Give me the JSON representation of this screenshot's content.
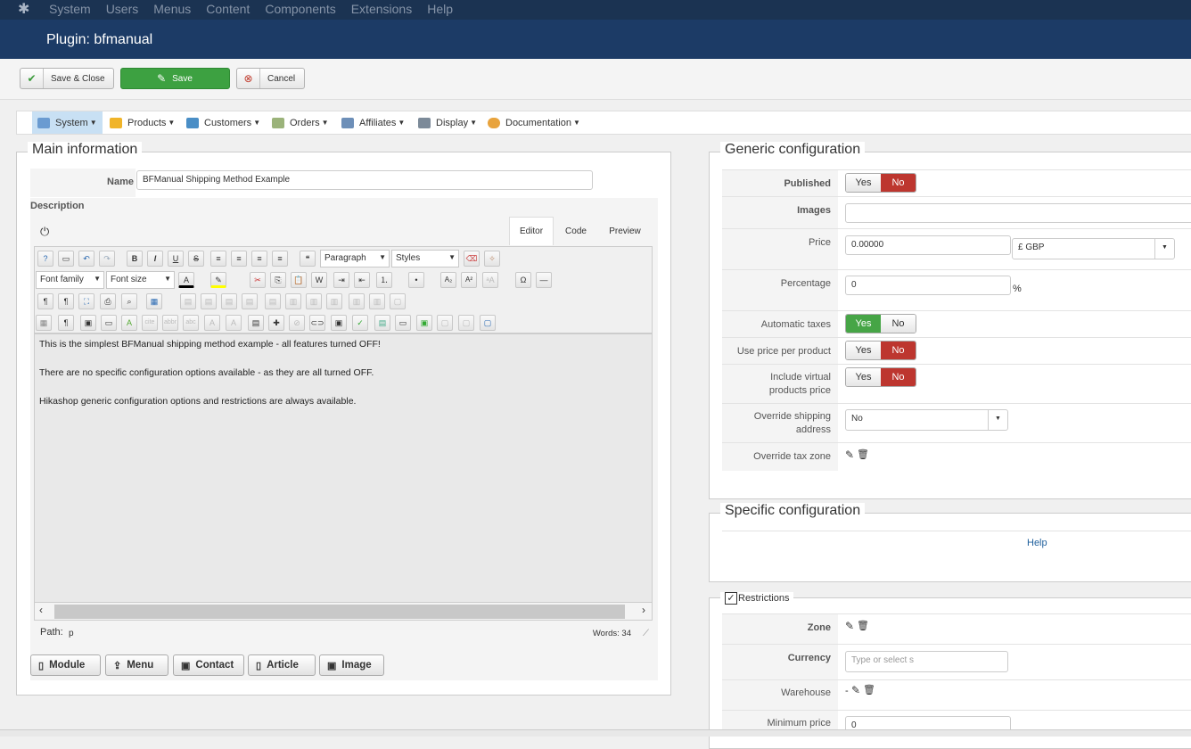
{
  "topnav": {
    "logo_icon": "joomla-logo-icon",
    "menu": [
      "System",
      "Users",
      "Menus",
      "Content",
      "Components",
      "Extensions",
      "Help"
    ]
  },
  "page_title": "Plugin: bfmanual",
  "toolbar": {
    "save_close": "Save & Close",
    "save": "Save",
    "cancel": "Cancel"
  },
  "hikamenu": [
    "System",
    "Products",
    "Customers",
    "Orders",
    "Affiliates",
    "Display",
    "Documentation"
  ],
  "main": {
    "legend": "Main information",
    "name_label": "Name",
    "name_value": "BFManual Shipping Method Example",
    "description_label": "Description",
    "tabs": [
      "Editor",
      "Code",
      "Preview"
    ],
    "format_select": "Paragraph",
    "styles_select": "Styles",
    "font_family": "Font family",
    "font_size": "Font size",
    "content": [
      "This is the simplest BFManual shipping method example - all features turned OFF!",
      "There are no specific configuration options available - as they are all turned OFF.",
      "Hikashop generic configuration options and restrictions are always available."
    ],
    "path_label": "Path:",
    "path_value": "p",
    "words": "Words: 34",
    "buttons": [
      "Module",
      "Menu",
      "Contact",
      "Article",
      "Image"
    ]
  },
  "generic": {
    "legend": "Generic configuration",
    "published_label": "Published",
    "images_label": "Images",
    "price_label": "Price",
    "price_value": "0.00000",
    "currency_value": "£ GBP",
    "percentage_label": "Percentage",
    "percentage_value": "0",
    "percent_sign": "%",
    "auto_taxes_label": "Automatic taxes",
    "price_per_product_label": "Use price per product",
    "virtual_label_1": "Include virtual",
    "virtual_label_2": "products price",
    "override_ship_label_1": "Override shipping",
    "override_ship_label_2": "address",
    "override_ship_value": "No",
    "override_tax_label": "Override tax zone",
    "yes": "Yes",
    "no": "No"
  },
  "specific": {
    "legend": "Specific configuration",
    "help": "Help"
  },
  "restrictions": {
    "legend": "Restrictions",
    "zone_label": "Zone",
    "currency_label": "Currency",
    "currency_placeholder": "Type or select s",
    "warehouse_label": "Warehouse",
    "warehouse_value": "-",
    "min_price_label": "Minimum price",
    "min_price_value": "0"
  },
  "colors": {
    "nav_bg": "#1b3352",
    "title_bg": "#1c3b66",
    "save_green": "#3da141",
    "toggle_red": "#bd362f",
    "toggle_green": "#46a546",
    "link_blue": "#1f5f9c"
  }
}
